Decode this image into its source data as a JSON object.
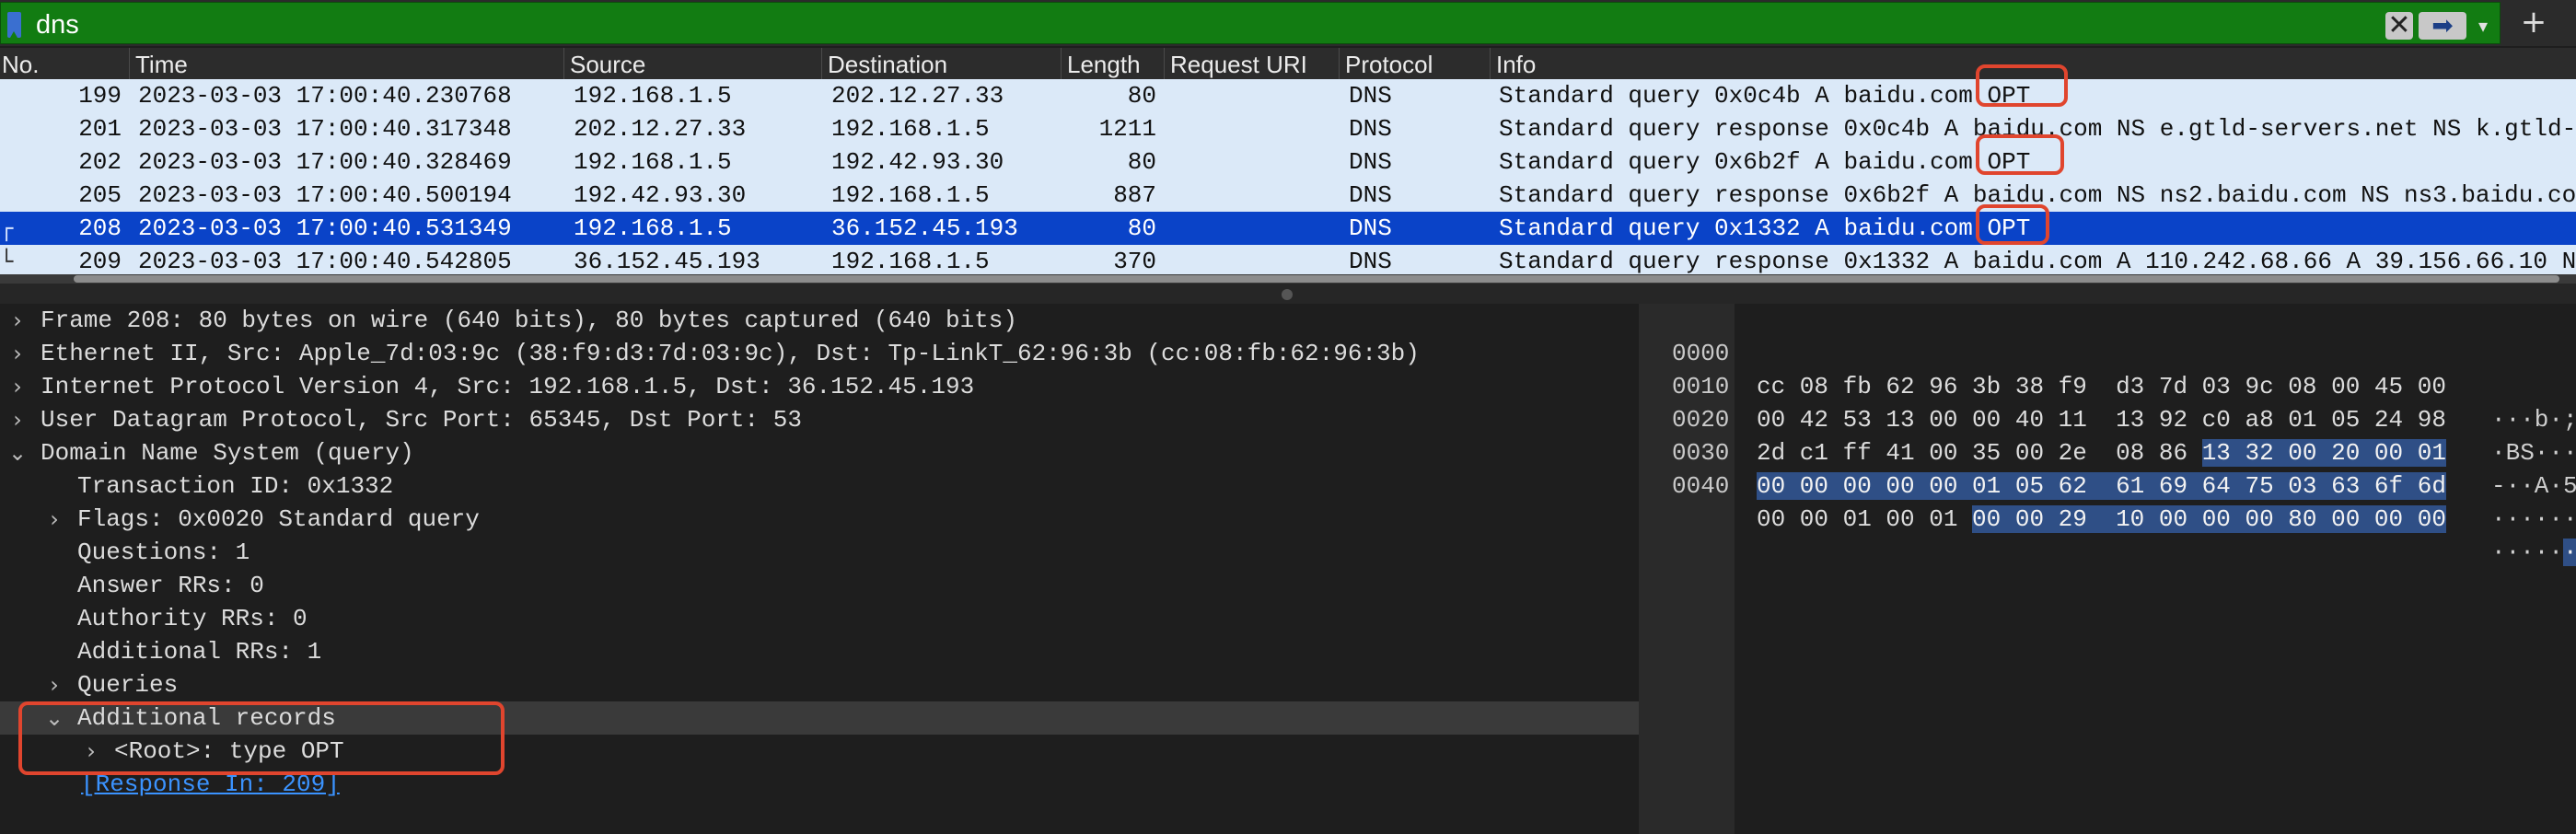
{
  "filter": {
    "value": "dns",
    "bookmark_icon": "bookmark-icon",
    "clear_icon": "clear-icon",
    "apply_icon": "arrow-right-icon",
    "dropdown_icon": "chevron-down-icon",
    "add_icon": "plus-icon",
    "color": "#127c12"
  },
  "packet_list": {
    "columns": [
      "No.",
      "Time",
      "Source",
      "Destination",
      "Length",
      "Request URI",
      "Protocol",
      "Info"
    ],
    "rows": [
      {
        "no": "199",
        "time": "2023-03-03 17:00:40.230768",
        "src": "192.168.1.5",
        "dst": "202.12.27.33",
        "len": "80",
        "proto": "DNS",
        "info": "Standard query 0x0c4b A baidu.com OPT",
        "selected": false
      },
      {
        "no": "201",
        "time": "2023-03-03 17:00:40.317348",
        "src": "202.12.27.33",
        "dst": "192.168.1.5",
        "len": "1211",
        "proto": "DNS",
        "info": "Standard query response 0x0c4b A baidu.com NS e.gtld-servers.net NS k.gtld-",
        "selected": false
      },
      {
        "no": "202",
        "time": "2023-03-03 17:00:40.328469",
        "src": "192.168.1.5",
        "dst": "192.42.93.30",
        "len": "80",
        "proto": "DNS",
        "info": "Standard query 0x6b2f A baidu.com OPT",
        "selected": false
      },
      {
        "no": "205",
        "time": "2023-03-03 17:00:40.500194",
        "src": "192.42.93.30",
        "dst": "192.168.1.5",
        "len": "887",
        "proto": "DNS",
        "info": "Standard query response 0x6b2f A baidu.com NS ns2.baidu.com NS ns3.baidu.co",
        "selected": false
      },
      {
        "no": "208",
        "time": "2023-03-03 17:00:40.531349",
        "src": "192.168.1.5",
        "dst": "36.152.45.193",
        "len": "80",
        "proto": "DNS",
        "info": "Standard query 0x1332 A baidu.com OPT",
        "selected": true
      },
      {
        "no": "209",
        "time": "2023-03-03 17:00:40.542805",
        "src": "36.152.45.193",
        "dst": "192.168.1.5",
        "len": "370",
        "proto": "DNS",
        "info": "Standard query response 0x1332 A baidu.com A 110.242.68.66 A 39.156.66.10 N",
        "selected": false
      }
    ],
    "selected_row_color": "#0a43c8",
    "row_color": "#dbe9f8"
  },
  "details": {
    "frame": "Frame 208: 80 bytes on wire (640 bits), 80 bytes captured (640 bits)",
    "ethernet": "Ethernet II, Src: Apple_7d:03:9c (38:f9:d3:7d:03:9c), Dst: Tp-LinkT_62:96:3b (cc:08:fb:62:96:3b)",
    "ip": "Internet Protocol Version 4, Src: 192.168.1.5, Dst: 36.152.45.193",
    "udp": "User Datagram Protocol, Src Port: 65345, Dst Port: 53",
    "dns": "Domain Name System (query)",
    "transaction_id": "Transaction ID: 0x1332",
    "flags": "Flags: 0x0020 Standard query",
    "questions": "Questions: 1",
    "answer_rrs": "Answer RRs: 0",
    "authority_rrs": "Authority RRs: 0",
    "additional_rrs": "Additional RRs: 1",
    "queries": "Queries",
    "additional_records": "Additional records",
    "root_opt": "<Root>: type OPT",
    "response_in": "[Response In: 209]",
    "expander_collapsed": "chevron-right-icon",
    "expander_expanded": "chevron-down-icon"
  },
  "hex": {
    "rows": [
      {
        "offset": "0000",
        "pre": "cc 08 fb 62 96 3b 38 f9  d3 7d 03 9c 08 00 45 00",
        "sel": "",
        "post": "",
        "ascii_pre": "···b·;",
        "ascii_sel": ""
      },
      {
        "offset": "0010",
        "pre": "00 42 53 13 00 00 40 11  13 92 c0 a8 01 05 24 98",
        "sel": "",
        "post": "",
        "ascii_pre": "·BS···",
        "ascii_sel": ""
      },
      {
        "offset": "0020",
        "pre": "2d c1 ff 41 00 35 00 2e  08 86 ",
        "sel": "13 32 00 20 00 01",
        "post": "",
        "ascii_pre": "-··A·5",
        "ascii_sel": ""
      },
      {
        "offset": "0030",
        "pre": "",
        "sel": "00 00 00 00 00 01 05 62  61 69 64 75 03 63 6f 6d",
        "post": "",
        "ascii_pre": "",
        "ascii_sel": "······"
      },
      {
        "offset": "0040",
        "pre": "00 00 01 00 01 ",
        "sel": "00 00 29  10 00 00 00 80 00 00 00",
        "post": "",
        "ascii_pre": "·····",
        "ascii_sel": "·"
      }
    ],
    "highlight_color": "#2f4f86"
  },
  "annotation_color": "#e0452e"
}
